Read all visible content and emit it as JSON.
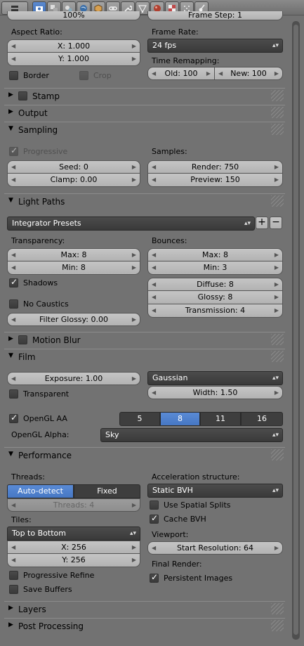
{
  "header": {
    "tabs": [
      "render",
      "render-layers",
      "scene",
      "world",
      "object",
      "constraints",
      "modifiers",
      "data",
      "material",
      "texture",
      "particles",
      "physics"
    ],
    "active_tab": "render"
  },
  "top": {
    "resolution_percent": "100%",
    "frame_step": "Frame Step: 1"
  },
  "dimensions": {
    "aspect_label": "Aspect Ratio:",
    "aspect_x": "X: 1.000",
    "aspect_y": "Y: 1.000",
    "border_label": "Border",
    "crop_label": "Crop",
    "frame_rate_label": "Frame Rate:",
    "frame_rate_value": "24 fps",
    "time_remap_label": "Time Remapping:",
    "old_value": "Old: 100",
    "new_value": "New: 100"
  },
  "panels": {
    "stamp": "Stamp",
    "output": "Output",
    "sampling": "Sampling",
    "light_paths": "Light Paths",
    "motion_blur": "Motion Blur",
    "film": "Film",
    "performance": "Performance",
    "layers": "Layers",
    "post_processing": "Post Processing"
  },
  "sampling": {
    "progressive_label": "Progressive",
    "seed": "Seed: 0",
    "clamp": "Clamp: 0.00",
    "samples_label": "Samples:",
    "render": "Render: 750",
    "preview": "Preview: 150"
  },
  "light_paths": {
    "integrator_presets": "Integrator Presets",
    "transparency_label": "Transparency:",
    "trans_max": "Max: 8",
    "trans_min": "Min: 8",
    "shadows_label": "Shadows",
    "no_caustics_label": "No Caustics",
    "filter_glossy": "Filter Glossy: 0.00",
    "bounces_label": "Bounces:",
    "bounce_max": "Max: 8",
    "bounce_min": "Min: 3",
    "diffuse": "Diffuse: 8",
    "glossy": "Glossy: 8",
    "transmission": "Transmission: 4"
  },
  "film": {
    "exposure": "Exposure: 1.00",
    "filter_type": "Gaussian",
    "width": "Width: 1.50",
    "transparent_label": "Transparent",
    "opengl_aa_label": "OpenGL AA",
    "aa_options": [
      "5",
      "8",
      "11",
      "16"
    ],
    "aa_selected": "8",
    "opengl_alpha_label": "OpenGL Alpha:",
    "opengl_alpha_value": "Sky"
  },
  "performance": {
    "threads_label": "Threads:",
    "auto_detect": "Auto-detect",
    "fixed": "Fixed",
    "threads_value": "Threads: 4",
    "tiles_label": "Tiles:",
    "tiles_order": "Top to Bottom",
    "tile_x": "X: 256",
    "tile_y": "Y: 256",
    "progressive_refine_label": "Progressive Refine",
    "save_buffers_label": "Save Buffers",
    "accel_label": "Acceleration structure:",
    "accel_value": "Static BVH",
    "spatial_splits_label": "Use Spatial Splits",
    "cache_bvh_label": "Cache BVH",
    "viewport_label": "Viewport:",
    "start_resolution": "Start Resolution: 64",
    "final_render_label": "Final Render:",
    "persistent_images_label": "Persistent Images"
  },
  "colors": {
    "background": "#727272",
    "selected_blue": "#4a7cc8",
    "dark_menu": "#404040"
  }
}
